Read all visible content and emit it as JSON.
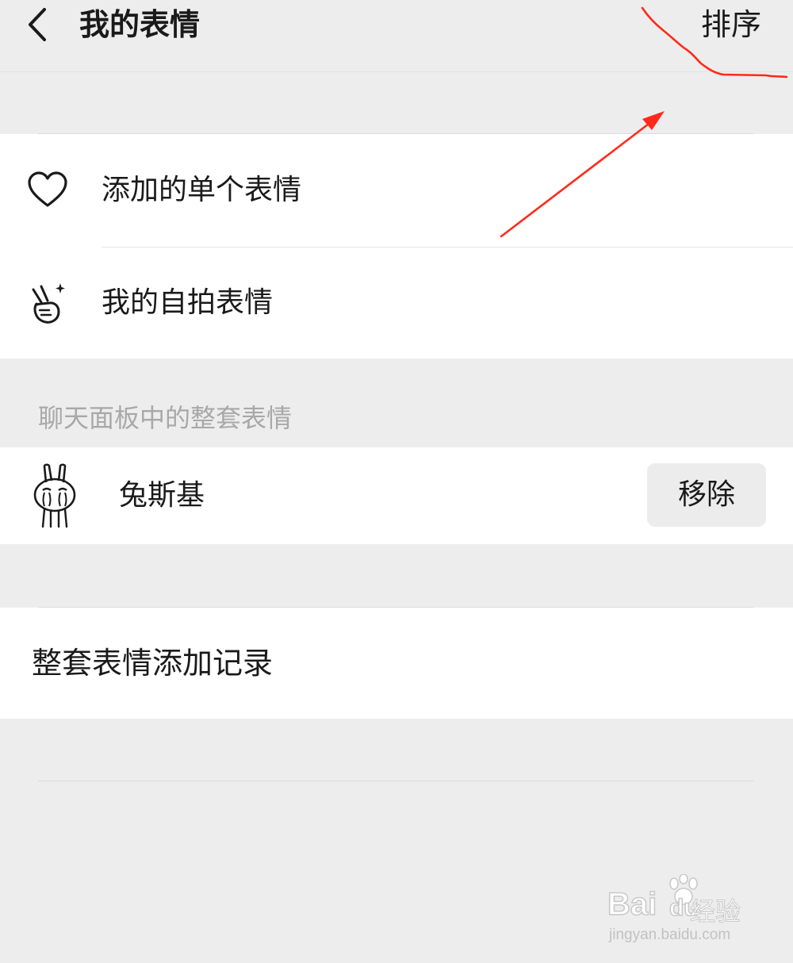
{
  "header": {
    "title": "我的表情",
    "sort_label": "排序"
  },
  "single_emojis": {
    "items": [
      {
        "label": "添加的单个表情",
        "icon": "heart-icon"
      },
      {
        "label": "我的自拍表情",
        "icon": "victory-hand-icon"
      }
    ]
  },
  "sets": {
    "section_title": "聊天面板中的整套表情",
    "items": [
      {
        "name": "兔斯基",
        "icon": "tuzki-icon",
        "action_label": "移除"
      }
    ]
  },
  "history": {
    "label": "整套表情添加记录"
  },
  "watermark": {
    "brand": "Bai",
    "brand_sub": "du",
    "product": "经验",
    "url": "jingyan.baidu.com"
  },
  "colors": {
    "annotation_red": "#ff2a1a",
    "background": "#ededed"
  }
}
